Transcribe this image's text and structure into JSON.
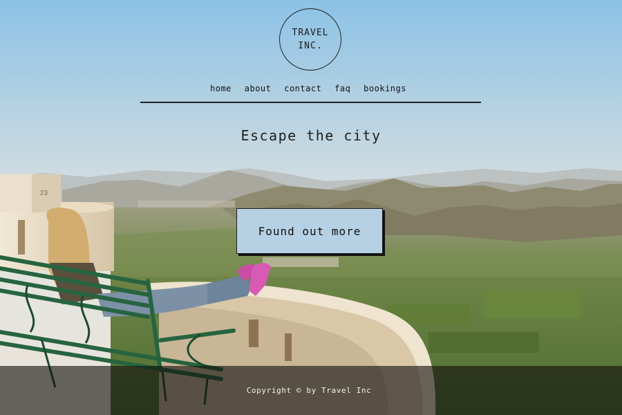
{
  "header": {
    "logo_line1": "TRAVEL",
    "logo_line2": "INC.",
    "nav": [
      "home",
      "about",
      "contact",
      "faq",
      "bookings"
    ]
  },
  "hero": {
    "tagline": "Escape the city",
    "cta_label": "Found out more",
    "image_description_icon": "hero-photo-woman-on-bench-overlooking-valley"
  },
  "footer": {
    "copyright": "Copyright © by Travel Inc"
  },
  "colors": {
    "sky_top": "#8fc3e6",
    "sky_horizon": "#e8e4dc",
    "cta_background": "#b6d1e3",
    "text_dark": "#1c1c1c",
    "footer_overlay": "#14120f"
  }
}
